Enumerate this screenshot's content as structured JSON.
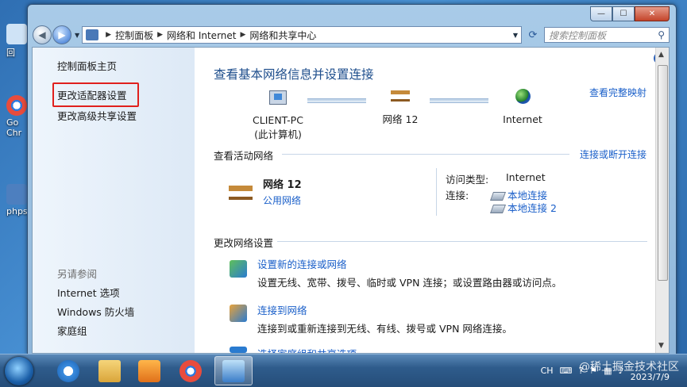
{
  "desktop": {
    "icons": [
      {
        "label": "回",
        "color": "#cfe3f6"
      },
      {
        "label": "Go\nChr",
        "color": "#e84c3d"
      },
      {
        "label": "phps",
        "color": "#4d7fbf"
      }
    ]
  },
  "window": {
    "caption_buttons": {
      "minimize": "—",
      "maximize": "☐",
      "close": "✕"
    },
    "nav": {
      "back_icon": "◀",
      "forward_icon": "▶",
      "dropdown_icon": "▼",
      "breadcrumb": [
        "控制面板",
        "网络和 Internet",
        "网络和共享中心"
      ],
      "breadcrumb_sep": "▶",
      "refresh_icon": "⟳",
      "search_placeholder": "搜索控制面板",
      "search_icon": "⚲"
    },
    "left_pane": {
      "home": "控制面板主页",
      "links": [
        "更改适配器设置",
        "更改高级共享设置"
      ],
      "see_also_title": "另请参阅",
      "see_also": [
        "Internet 选项",
        "Windows 防火墙",
        "家庭组"
      ]
    },
    "main": {
      "help_icon": "?",
      "title": "查看基本网络信息并设置连接",
      "full_map_link": "查看完整映射",
      "map": {
        "computer": {
          "name": "CLIENT-PC",
          "sub": "(此计算机)"
        },
        "network": {
          "name": "网络  12"
        },
        "internet": {
          "name": "Internet"
        }
      },
      "active_networks": {
        "header": "查看活动网络",
        "connect_link": "连接或断开连接",
        "network_name": "网络  12",
        "network_type": "公用网络",
        "access_type_label": "访问类型:",
        "access_type_value": "Internet",
        "connections_label": "连接:",
        "connections": [
          "本地连接",
          "本地连接 2"
        ]
      },
      "change_settings": {
        "header": "更改网络设置",
        "tasks": [
          {
            "link": "设置新的连接或网络",
            "desc": "设置无线、宽带、拨号、临时或 VPN 连接；或设置路由器或访问点。"
          },
          {
            "link": "连接到网络",
            "desc": "连接到或重新连接到无线、有线、拨号或 VPN 网络连接。"
          },
          {
            "link": "选择家庭组和共享选项",
            "desc": ""
          }
        ]
      }
    }
  },
  "taskbar": {
    "apps": [
      "ie",
      "explorer",
      "media-player",
      "chrome",
      "network-center"
    ],
    "tray": {
      "lang": "CH",
      "date": "2023/7/9",
      "time": ""
    },
    "watermark": "@稀土掘金技术社区"
  },
  "colors": {
    "link": "#1a5fc9",
    "title": "#1e4e8c",
    "highlight": "#e0201d"
  }
}
